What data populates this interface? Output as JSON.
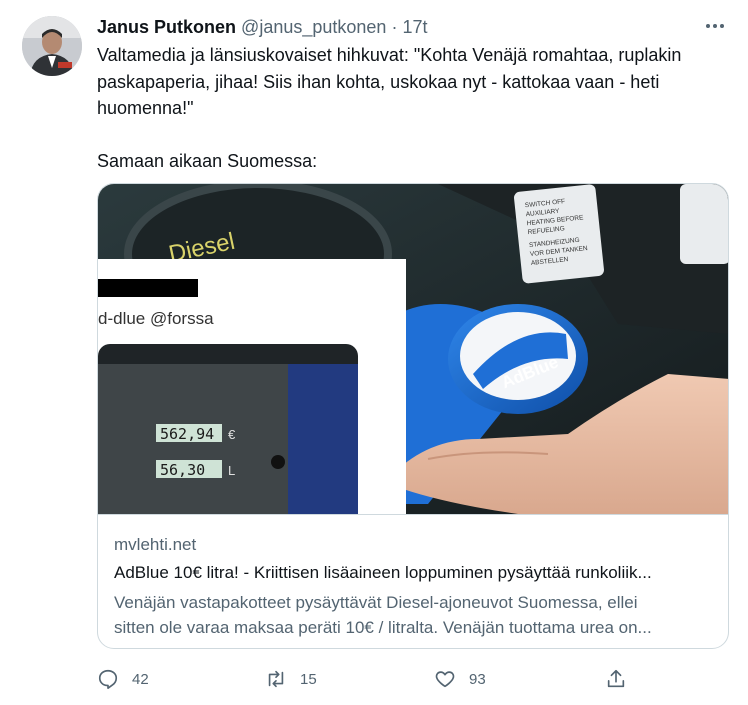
{
  "tweet": {
    "author_name": "Janus Putkonen",
    "handle": "@janus_putkonen",
    "separator": "·",
    "time": "17t",
    "text_p1": "Valtamedia ja länsiuskovaiset hihkuvat: \"Kohta Venäjä romahtaa, ruplakin paskapaperia, jihaa! Siis ihan kohta, uskokaa nyt - kattokaa vaan - heti huomenna!\"",
    "text_p2": "Samaan aikaan Suomessa:"
  },
  "card": {
    "domain": "mvlehti.net",
    "title": "AdBlue 10€ litra! - Kriittisen lisäaineen loppuminen pysäyttää runkoliik...",
    "description_line1": "Venäjän vastapakotteet pysäyttävät Diesel-ajoneuvot Suomessa, ellei",
    "description_line2": "sitten ole varaa maksaa peräti 10€ / litralta. Venäjän tuottama urea on...",
    "image": {
      "diesel_label": "Diesel",
      "cap_label": "AdBlue",
      "inset_handle": "d-dlue @forssa",
      "price_display": "562,94",
      "price_unit": "€",
      "volume_display": "56,30",
      "volume_unit": "L",
      "warning_label_lines": [
        "SWITCH OFF",
        "AUXILIARY",
        "HEATING BEFORE",
        "REFUELING",
        "STANDHEIZUNG",
        "VOR DEM TANKEN",
        "ABSTELLEN"
      ]
    }
  },
  "actions": {
    "replies": "42",
    "retweets": "15",
    "likes": "93"
  },
  "colors": {
    "text": "#0f1419",
    "secondary": "#536471",
    "border": "#cfd9de",
    "adblue": "#1f6fd6"
  }
}
